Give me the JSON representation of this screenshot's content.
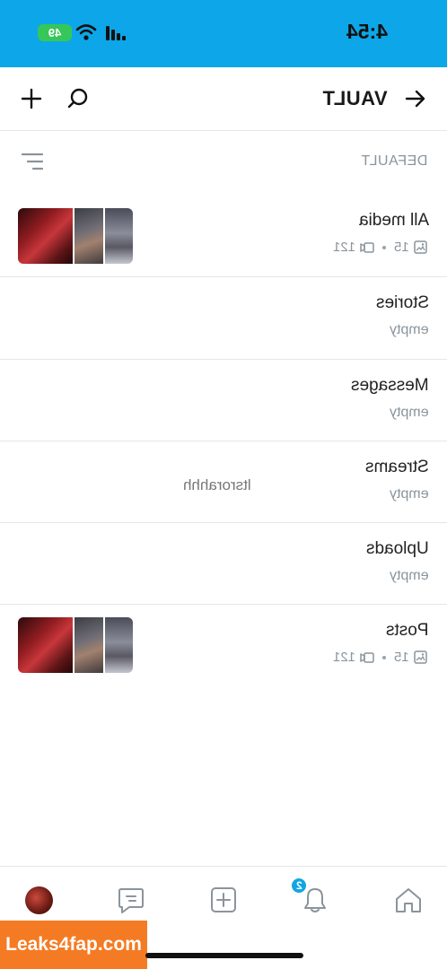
{
  "status_bar": {
    "time": "4:54",
    "battery": "49"
  },
  "header": {
    "title": "VAULT",
    "back_icon": "arrow-right-icon",
    "search_icon": "search-icon",
    "add_icon": "plus-icon"
  },
  "filter": {
    "label": "DEFAULT",
    "icon": "sort-lines-icon"
  },
  "lists": [
    {
      "title": "All media",
      "photos": "15",
      "videos": "121",
      "subtitle": "",
      "extra": ""
    },
    {
      "title": "Stories",
      "photos": "",
      "videos": "",
      "subtitle": "empty",
      "extra": ""
    },
    {
      "title": "Messages",
      "photos": "",
      "videos": "",
      "subtitle": "empty",
      "extra": ""
    },
    {
      "title": "Streams",
      "photos": "",
      "videos": "",
      "subtitle": "empty",
      "extra": "ltsrorahhh"
    },
    {
      "title": "Uploads",
      "photos": "",
      "videos": "",
      "subtitle": "empty",
      "extra": ""
    },
    {
      "title": "Posts",
      "photos": "15",
      "videos": "121",
      "subtitle": "",
      "extra": ""
    }
  ],
  "bottom_nav": {
    "items": [
      "avatar",
      "messages-icon",
      "add-post-icon",
      "notifications-icon",
      "home-icon"
    ],
    "notifications_badge": "2"
  },
  "watermark": "Leaks4fap.com",
  "colors": {
    "accent": "#0da6e8",
    "badge": "#12a5e3",
    "battery": "#35c759",
    "muted_text": "#8a949c"
  }
}
